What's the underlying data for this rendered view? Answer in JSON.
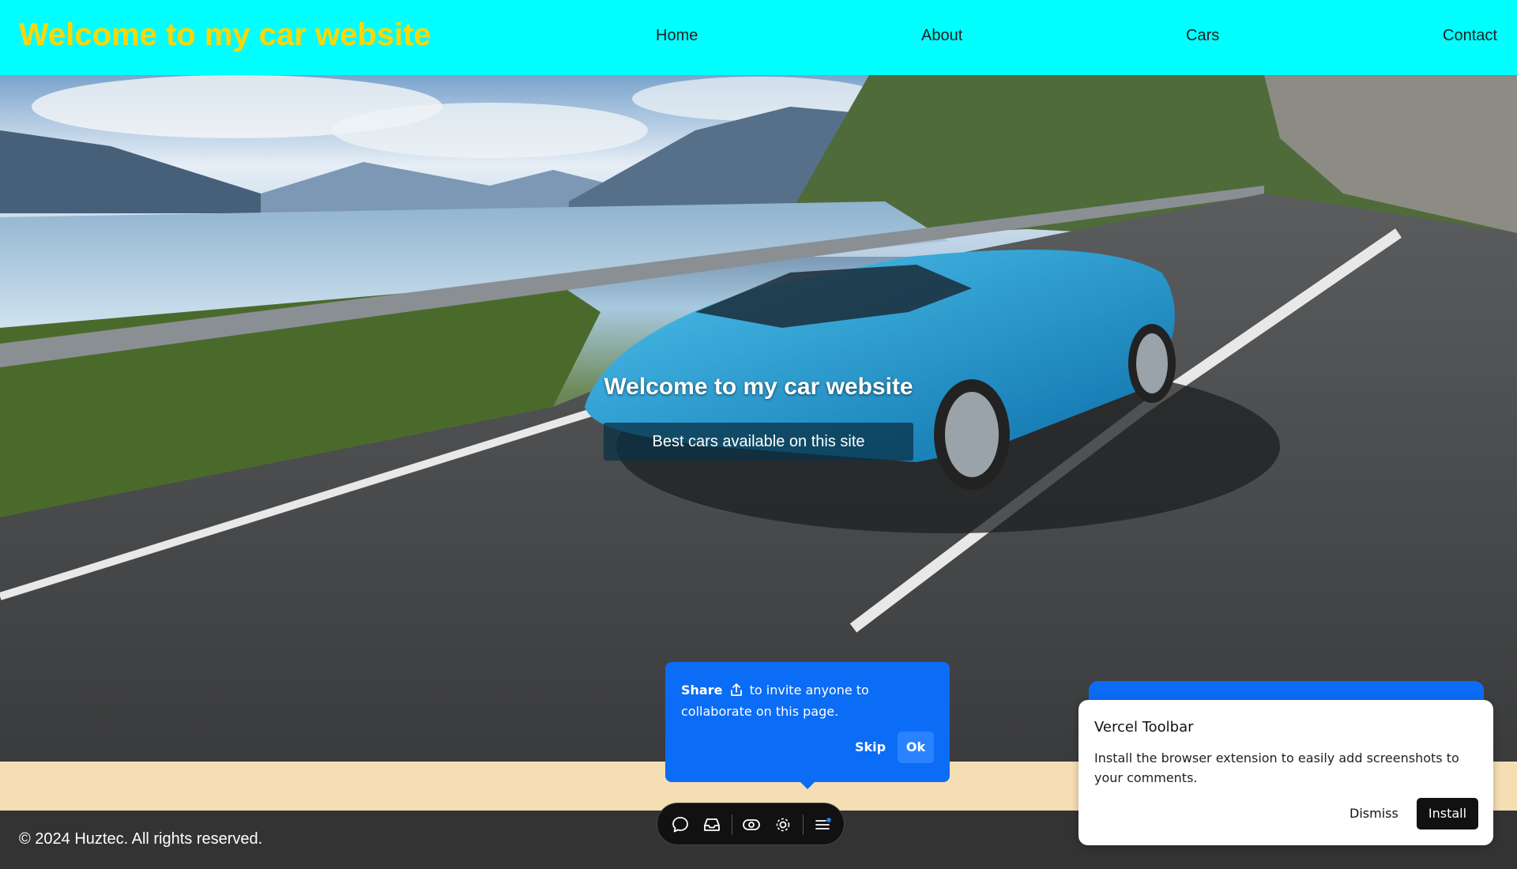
{
  "header": {
    "brand": "Welcome to my car website",
    "nav": [
      {
        "label": "Home"
      },
      {
        "label": "About"
      },
      {
        "label": "Cars"
      },
      {
        "label": "Contact"
      }
    ]
  },
  "hero": {
    "title": "Welcome to my car website",
    "subtitle": "Best cars available on this site"
  },
  "footer": {
    "copyright": "© 2024 Huztec. All rights reserved."
  },
  "share_popup": {
    "bold": "Share",
    "text": "to invite anyone to collaborate on this page.",
    "skip_label": "Skip",
    "ok_label": "Ok"
  },
  "toolbar": {
    "icons": [
      "comment-icon",
      "inbox-icon",
      "eye-icon",
      "settings-icon",
      "menu-icon"
    ]
  },
  "vercel_card": {
    "title": "Vercel Toolbar",
    "description": "Install the browser extension to easily add screenshots to your comments.",
    "dismiss_label": "Dismiss",
    "install_label": "Install"
  },
  "colors": {
    "header_bg": "#00ffff",
    "brand_color": "#ffd700",
    "strip_bg": "#f5deb3",
    "footer_bg": "#333333",
    "accent_blue": "#0b6cf6"
  }
}
